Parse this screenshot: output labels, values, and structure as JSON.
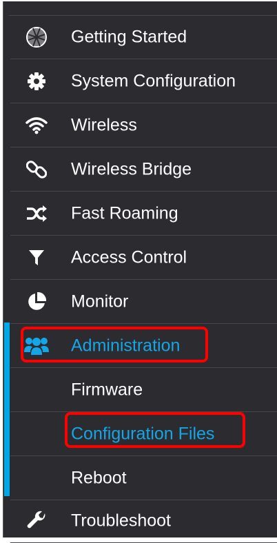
{
  "nav": {
    "items": [
      {
        "label": "Getting Started",
        "icon": "globe-icon"
      },
      {
        "label": "System Configuration",
        "icon": "gear-icon"
      },
      {
        "label": "Wireless",
        "icon": "wifi-icon"
      },
      {
        "label": "Wireless Bridge",
        "icon": "link-icon"
      },
      {
        "label": "Fast Roaming",
        "icon": "shuffle-icon"
      },
      {
        "label": "Access Control",
        "icon": "filter-icon"
      },
      {
        "label": "Monitor",
        "icon": "pie-chart-icon"
      },
      {
        "label": "Administration",
        "icon": "users-icon"
      },
      {
        "label": "Troubleshoot",
        "icon": "wrench-icon"
      }
    ],
    "subitems": [
      {
        "label": "Firmware"
      },
      {
        "label": "Configuration Files"
      },
      {
        "label": "Reboot"
      }
    ]
  },
  "colors": {
    "sidebar_bg": "#2c2b30",
    "text": "#ffffff",
    "accent": "#14a6e6",
    "highlight": "#ff0000"
  }
}
